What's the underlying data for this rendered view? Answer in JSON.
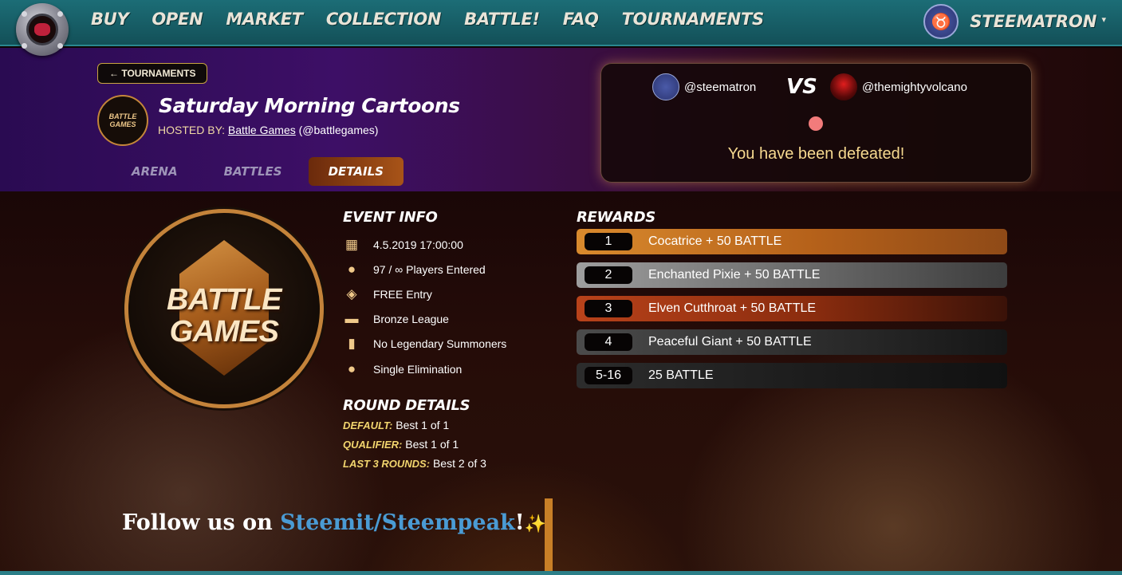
{
  "nav": {
    "items": [
      "BUY",
      "OPEN",
      "MARKET",
      "COLLECTION",
      "BATTLE!",
      "FAQ",
      "TOURNAMENTS"
    ],
    "user": "STEEMATRON",
    "caret": "▾"
  },
  "header": {
    "back_label": "TOURNAMENTS",
    "back_icon": "←",
    "host_logo_line1": "BATTLE",
    "host_logo_line2": "GAMES",
    "title": "Saturday Morning Cartoons",
    "hosted_prefix": "HOSTED BY:",
    "host_name": "Battle Games",
    "host_handle": "(@battlegames)",
    "tabs": [
      "ARENA",
      "BATTLES",
      "DETAILS"
    ],
    "active_tab": "DETAILS"
  },
  "battle": {
    "player1": "@steematron",
    "vs": "VS",
    "player2": "@themightyvolcano",
    "result": "You have been defeated!"
  },
  "logo": {
    "line1": "BATTLE",
    "line2": "GAMES"
  },
  "event_info": {
    "heading": "EVENT INFO",
    "rows": [
      {
        "icon": "calendar-icon",
        "glyph": "▦",
        "text": "4.5.2019 17:00:00"
      },
      {
        "icon": "player-icon",
        "glyph": "●",
        "text": "97 / ∞ Players Entered"
      },
      {
        "icon": "ticket-icon",
        "glyph": "◈",
        "text": "FREE Entry"
      },
      {
        "icon": "league-icon",
        "glyph": "▬",
        "text": "Bronze League"
      },
      {
        "icon": "cards-icon",
        "glyph": "▮",
        "text": "No Legendary Summoners"
      },
      {
        "icon": "elimination-icon",
        "glyph": "●",
        "text": "Single Elimination"
      }
    ]
  },
  "round_details": {
    "heading": "ROUND DETAILS",
    "rows": [
      {
        "label": "DEFAULT:",
        "value": " Best 1 of 1"
      },
      {
        "label": "QUALIFIER:",
        "value": " Best 1 of 1"
      },
      {
        "label": "LAST 3 ROUNDS:",
        "value": " Best 2 of 3"
      }
    ]
  },
  "rewards": {
    "heading": "REWARDS",
    "rows": [
      {
        "place": "1",
        "reward": "Cocatrice + 50 BATTLE"
      },
      {
        "place": "2",
        "reward": "Enchanted Pixie + 50 BATTLE"
      },
      {
        "place": "3",
        "reward": "Elven Cutthroat + 50 BATTLE"
      },
      {
        "place": "4",
        "reward": "Peaceful Giant + 50 BATTLE"
      },
      {
        "place": "5-16",
        "reward": "25 BATTLE"
      }
    ]
  },
  "follow": {
    "prefix": "Follow us on ",
    "link": "Steemit/Steempeak",
    "suffix": "!",
    "spark": "✨"
  },
  "colors": {
    "nav_bg": "#1c6d76",
    "accent_gold": "#c4833a",
    "defeat_text": "#f6d98f",
    "link_blue": "#4a9bd4"
  }
}
